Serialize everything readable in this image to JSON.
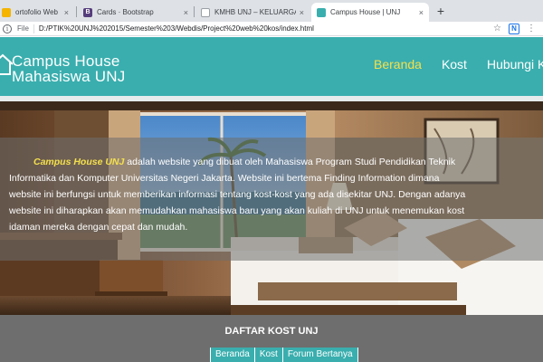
{
  "browser": {
    "tabs": [
      {
        "title": "ortofolio Web",
        "close": "×",
        "fav_color": "#f4b400",
        "fav_letter": ""
      },
      {
        "title": "Cards · Bootstrap",
        "close": "×",
        "fav_color": "#563d7c",
        "fav_letter": "B"
      },
      {
        "title": "KMHB UNJ – KELUARGA MA",
        "close": "×",
        "fav_color": "#5f6368",
        "fav_letter": ""
      },
      {
        "title": "Campus House | UNJ",
        "close": "×",
        "fav_color": "#3aaeae",
        "fav_letter": ""
      }
    ],
    "new_tab_label": "+",
    "url_scheme_label": "File",
    "url": "D:/PTIK%20UNJ%202015/Semester%203/Webdis/Project%20web%20kos/index.html",
    "info_icon": "i",
    "bookmark_icon": "☆",
    "extension_label": "N",
    "profile_icon": "⋮"
  },
  "header": {
    "brand_line1": "Campus House",
    "brand_line2": "Mahasiswa UNJ",
    "nav": [
      {
        "label": "Beranda",
        "active": true
      },
      {
        "label": "Kost",
        "active": false
      },
      {
        "label": "Hubungi Kami",
        "active": false
      }
    ]
  },
  "hero": {
    "brand_name": "Campus House UNJ",
    "line1_rest": " adalah website yang dibuat oleh Mahasiswa Program Studi Pendidikan Teknik",
    "line2": "Informatika dan Komputer Universitas Negeri Jakarta. Website ini bertema Finding Information dimana",
    "line3": "website ini berfungsi untuk memberikan informasi tentang kost-kost yang ada disekitar UNJ. Dengan adanya",
    "line4": "website ini diharapkan akan memudahkan mahasiswa baru yang akan kuliah di UNJ untuk menemukan kost",
    "line5": "idaman mereka dengan cepat dan mudah."
  },
  "footer": {
    "title": "DAFTAR KOST UNJ",
    "links": [
      "Beranda",
      "Kost",
      "Forum Bertanya"
    ]
  },
  "colors": {
    "accent": "#3aaeae",
    "active_nav": "#f4e04d",
    "footer_bg": "#6e6e6e"
  }
}
